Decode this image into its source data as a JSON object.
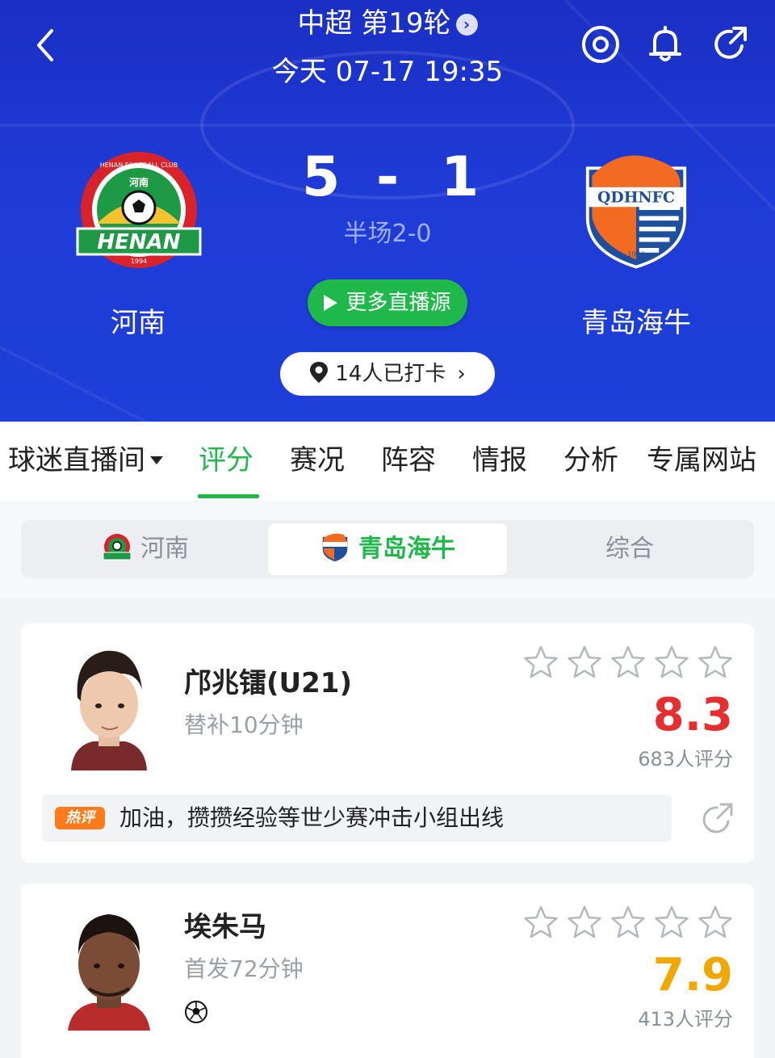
{
  "header": {
    "league": "中超 第19轮",
    "match_time": "今天 07-17 19:35",
    "home_team": "河南",
    "away_team": "青岛海牛",
    "home_score": "5",
    "score_separator": "-",
    "away_score": "1",
    "halftime": "半场2-0",
    "live_button": "更多直播源",
    "checkin": "14人已打卡",
    "home_logo_text": {
      "top": "HENAN FOOTBALL CLUB",
      "cn": "河南",
      "main": "HENAN",
      "year": "1994"
    },
    "away_logo_text": {
      "main": "QDHNFC",
      "year": "1993"
    },
    "icons": [
      "back-icon",
      "target-icon",
      "bell-icon",
      "share-icon"
    ]
  },
  "tabs": [
    {
      "label": "球迷直播间",
      "active": false
    },
    {
      "label": "评分",
      "active": true
    },
    {
      "label": "赛况",
      "active": false
    },
    {
      "label": "阵容",
      "active": false
    },
    {
      "label": "情报",
      "active": false
    },
    {
      "label": "分析",
      "active": false
    },
    {
      "label": "专属网站",
      "active": false
    }
  ],
  "segmented": [
    {
      "label": "河南",
      "active": false
    },
    {
      "label": "青岛海牛",
      "active": true
    },
    {
      "label": "综合",
      "active": false
    }
  ],
  "players": [
    {
      "name": "邝兆镭(U21)",
      "sub": "替补10分钟",
      "rating": "8.3",
      "rating_color": "#e62e2e",
      "rating_count": "683人评分",
      "comment_tag": "热评",
      "comment": "加油，攒攒经验等世少赛冲击小组出线"
    },
    {
      "name": "埃朱马",
      "sub": "首发72分钟",
      "rating": "7.9",
      "rating_color": "#f0a800",
      "rating_count": "413人评分",
      "event_icon": "football-icon"
    }
  ],
  "colors": {
    "header_blue": "#1f3bd6",
    "accent_green": "#1fb84a",
    "hot_orange": "#ff7a1a"
  }
}
